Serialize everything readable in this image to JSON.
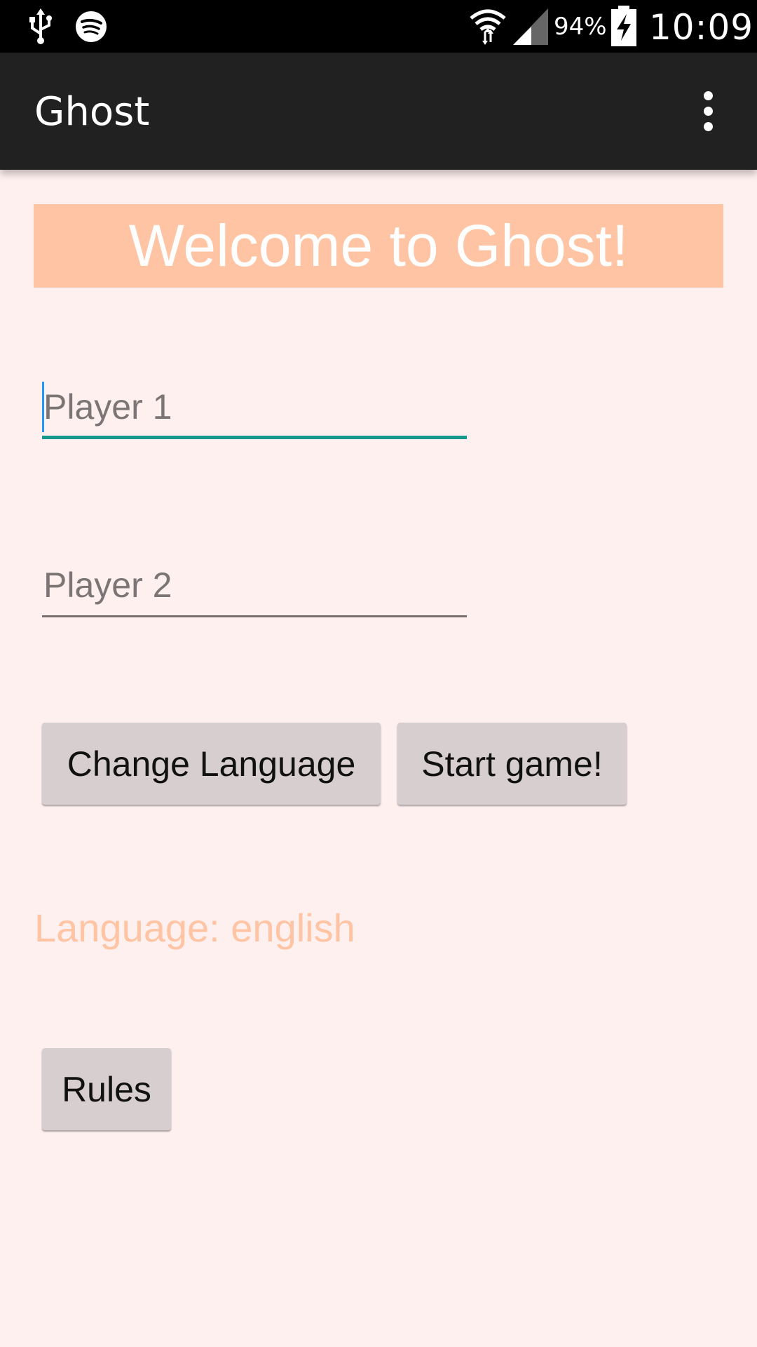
{
  "status_bar": {
    "battery_percent": "94%",
    "time": "10:09",
    "icons": [
      "usb-icon",
      "spotify-icon",
      "wifi-icon",
      "signal-icon",
      "battery-charging-icon"
    ]
  },
  "app_bar": {
    "title": "Ghost",
    "overflow_icon": "more-vert-icon"
  },
  "banner": {
    "text": "Welcome to Ghost!",
    "background": "#ffc4a3"
  },
  "form": {
    "player1_placeholder": "Player 1",
    "player1_value": "",
    "player2_placeholder": "Player 2",
    "player2_value": "",
    "focus_color": "#14998c"
  },
  "buttons": {
    "change_language": "Change Language",
    "start_game": "Start game!",
    "rules": "Rules"
  },
  "language_status": "Language: english",
  "colors": {
    "accent": "#ffc4a3",
    "background": "#fff0f0",
    "app_bar": "#212121"
  }
}
